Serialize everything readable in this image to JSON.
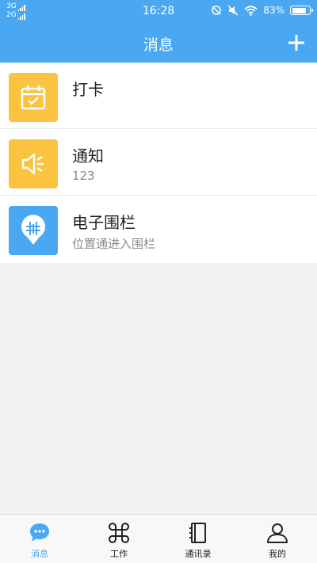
{
  "status_bar": {
    "network_1": "3G",
    "network_2": "2G",
    "time": "16:28",
    "battery": "83%",
    "battery_level": 0.83
  },
  "header": {
    "title": "消息",
    "add_icon": "plus-icon"
  },
  "messages": [
    {
      "title": "打卡",
      "subtitle": "",
      "icon": "calendar-check-icon",
      "color": "#fbc440"
    },
    {
      "title": "通知",
      "subtitle": "123",
      "icon": "speaker-icon",
      "color": "#fbc440"
    },
    {
      "title": "电子围栏",
      "subtitle": "位置通进入围栏",
      "icon": "geofence-pin-icon",
      "color": "#4aa8f2"
    }
  ],
  "tabbar": {
    "active": 0,
    "tabs": [
      {
        "label": "消息",
        "icon": "chat-bubble-icon"
      },
      {
        "label": "工作",
        "icon": "command-icon"
      },
      {
        "label": "通讯录",
        "icon": "contacts-book-icon"
      },
      {
        "label": "我的",
        "icon": "person-icon"
      }
    ]
  },
  "colors": {
    "primary": "#4aa8f2",
    "yellow": "#fbc440",
    "background": "#f0f1f3"
  }
}
